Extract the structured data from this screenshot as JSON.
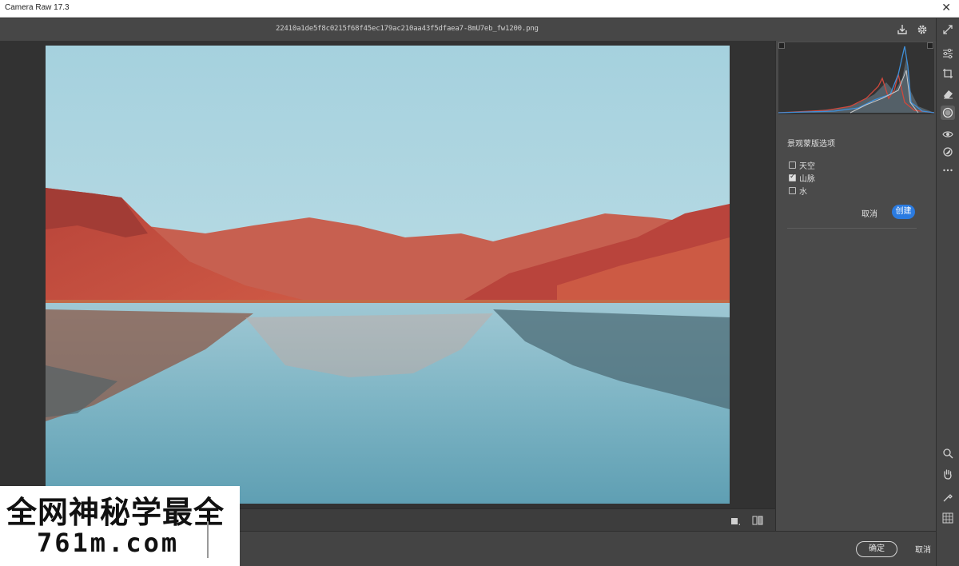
{
  "window": {
    "title": "Camera Raw 17.3",
    "close_icon": "close-icon"
  },
  "toolbar": {
    "filename": "22410a1de5f8c0215f68f45ec179ac210aa43f5dfaea7-8mU7eb_fw1200.png",
    "icons": [
      "save-icon",
      "gear-icon",
      "fullscreen-icon"
    ]
  },
  "panel": {
    "options_title": "景观蒙版选项",
    "options": [
      {
        "label": "天空",
        "checked": false
      },
      {
        "label": "山脉",
        "checked": true
      },
      {
        "label": "水",
        "checked": false
      }
    ],
    "cancel_label": "取消",
    "create_label": "创建"
  },
  "footer": {
    "ok_label": "确定",
    "cancel_label": "取消"
  },
  "strip_icons": [
    "edit-sliders-icon",
    "crop-icon",
    "eraser-icon",
    "mask-icon",
    "red-eye-icon",
    "presets-icon",
    "more-icon",
    "zoom-icon",
    "hand-icon",
    "sampler-icon",
    "grid-icon"
  ],
  "watermark": {
    "line1": "全网神秘学最全",
    "line2": "761m.com"
  },
  "colors": {
    "accent": "#2b7be0",
    "background": "#3a3a3a",
    "panel": "#4a4a4a"
  }
}
